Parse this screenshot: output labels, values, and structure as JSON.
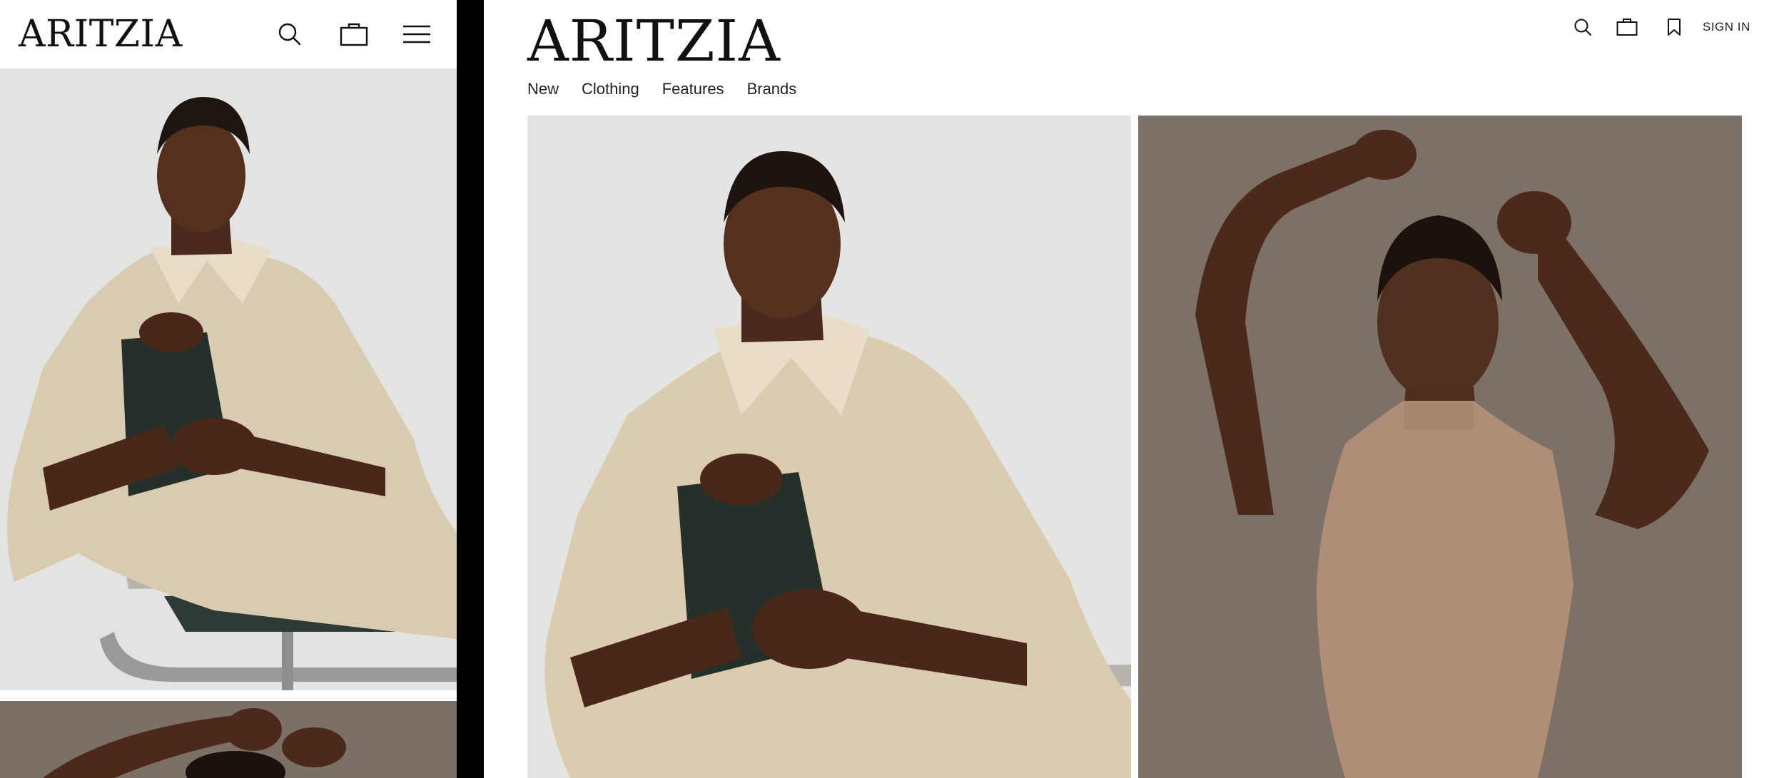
{
  "brand": {
    "logo_text": "ARITZIA"
  },
  "mobile": {
    "header": {
      "icons": [
        "search-icon",
        "shopping-bag-icon",
        "hamburger-menu-icon"
      ]
    }
  },
  "desktop": {
    "nav": {
      "items": [
        {
          "label": "New"
        },
        {
          "label": "Clothing"
        },
        {
          "label": "Features"
        },
        {
          "label": "Brands"
        }
      ]
    },
    "utility": {
      "icons": [
        "search-icon",
        "shopping-bag-icon",
        "bookmark-icon"
      ],
      "sign_in_label": "SIGN IN"
    }
  },
  "colors": {
    "text": "#111111",
    "divider": "#000000",
    "hero1_bg": "#e4e4e2",
    "hero2_bg": "#7d7167"
  }
}
